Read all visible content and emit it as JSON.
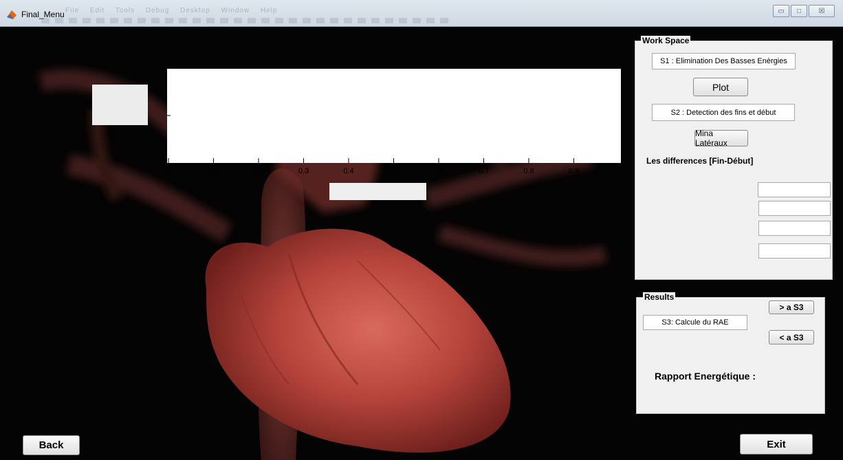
{
  "window": {
    "title": "Final_Menu",
    "menu": [
      "File",
      "Edit",
      "Tools",
      "Debug",
      "Desktop",
      "Window",
      "Help"
    ],
    "minimize_label": "▭",
    "maximize_label": "□",
    "close_label": "☒"
  },
  "axes": {
    "x_ticks": [
      "0",
      "0.1",
      "0.2",
      "0.3",
      "0.4",
      "0.5",
      "0.6",
      "0.7",
      "0.8",
      "0.9"
    ]
  },
  "workspace": {
    "title": "Work Space",
    "s1_label": "S1 : Elimination Des Basses Enèrgies",
    "plot_button": "Plot",
    "s2_label": "S2 : Detection des fins et début",
    "mina_button": "Mina Latéraux",
    "differences_label": "Les differences [Fin-Début]",
    "diff_fields": [
      "",
      "",
      "",
      ""
    ]
  },
  "results": {
    "title": "Results",
    "next_button": "> a S3",
    "s3_label": "S3: Calcule du RAE",
    "prev_button": "< a S3",
    "ratio_label": "Rapport Energétique :"
  },
  "footer": {
    "back_button": "Back",
    "exit_button": "Exit"
  },
  "colors": {
    "background": "#050404",
    "panel": "#f0f0f0",
    "heart_red": "#b8453c"
  }
}
